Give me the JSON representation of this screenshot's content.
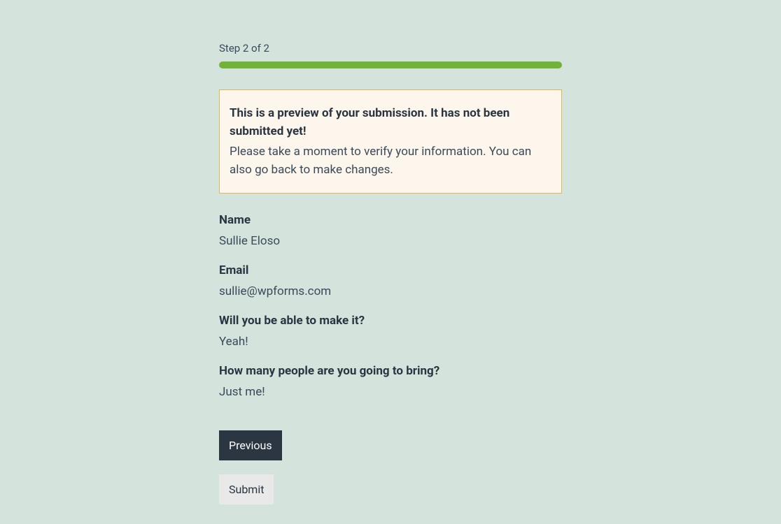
{
  "progress": {
    "step_label": "Step 2 of 2"
  },
  "notice": {
    "title": "This is a preview of your submission. It has not been submitted yet!",
    "text": "Please take a moment to verify your information. You can also go back to make changes."
  },
  "fields": {
    "name": {
      "label": "Name",
      "value": "Sullie Eloso"
    },
    "email": {
      "label": "Email",
      "value": "sullie@wpforms.com"
    },
    "attendance": {
      "label": "Will you be able to make it?",
      "value": "Yeah!"
    },
    "guests": {
      "label": "How many people are you going to bring?",
      "value": "Just me!"
    }
  },
  "buttons": {
    "previous": "Previous",
    "submit": "Submit"
  }
}
